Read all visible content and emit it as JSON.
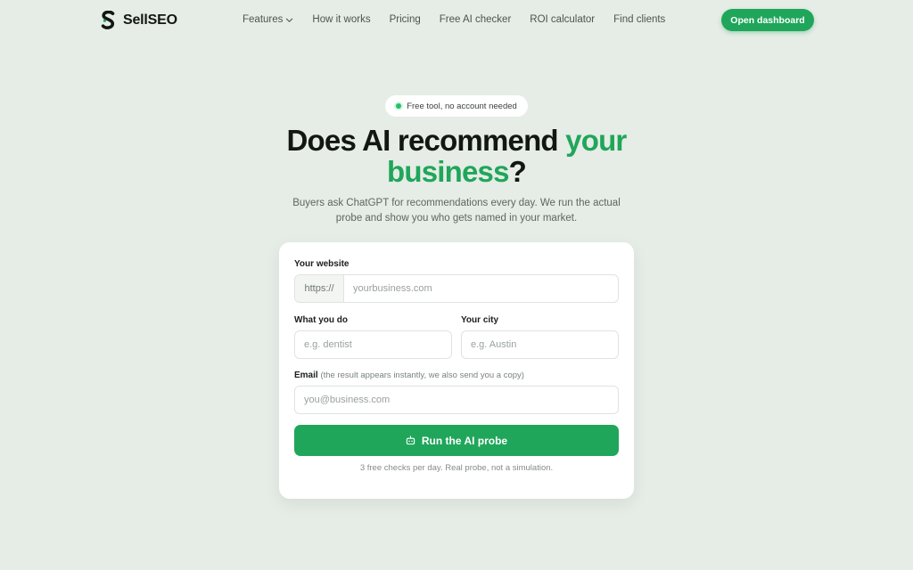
{
  "nav": {
    "brand": "SellSEO",
    "links": [
      "Features",
      "How it works",
      "Pricing",
      "Free AI checker",
      "ROI calculator",
      "Find clients"
    ],
    "cta": "Open dashboard"
  },
  "hero": {
    "badge": "Free tool, no account needed",
    "headline_part1": "Does AI recommend ",
    "headline_green1": "your",
    "headline_green2": "business",
    "headline_end": "?",
    "subtitle": "Buyers ask ChatGPT for recommendations every day. We run the actual probe and show you who gets named in your market."
  },
  "form": {
    "website_label": "Your website",
    "website_prefix": "https://",
    "website_placeholder": "yourbusiness.com",
    "business_label": "What you do",
    "business_placeholder": "e.g. dentist",
    "city_label": "Your city",
    "city_placeholder": "e.g. Austin",
    "email_label": "Email",
    "email_hint": "(the result appears instantly, we also send you a copy)",
    "email_placeholder": "you@business.com",
    "submit_label": "Run the AI probe",
    "footnote": "3 free checks per day. Real probe, not a simulation."
  },
  "colors": {
    "accent": "#1fa65a",
    "background": "#e6ece6",
    "card": "#ffffff"
  },
  "icons": {
    "logo": "sellseo-s-logo",
    "features_dropdown": "chevron-down-icon",
    "badge": "status-dot",
    "submit": "robot-icon"
  }
}
